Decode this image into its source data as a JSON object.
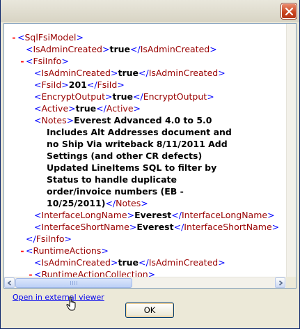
{
  "window": {
    "close_label": "close"
  },
  "xml": {
    "root_open": "SqlFsiModel",
    "root_isadmin_tag": "IsAdminCreated",
    "root_isadmin_val": "true",
    "fsiinfo_tag": "FsiInfo",
    "fsi_isadmin_tag": "IsAdminCreated",
    "fsi_isadmin_val": "true",
    "fsiid_tag": "FsiId",
    "fsiid_val": "201",
    "encrypt_tag": "EncryptOutput",
    "encrypt_val": "true",
    "active_tag": "Active",
    "active_val": "true",
    "notes_tag": "Notes",
    "notes_lines": [
      "Everest Advanced 4.0 to 5.0",
      "Includes Alt Addresses document and",
      "no Ship Via writeback 8/11/2011 Add",
      "Settings (and other CR defects)",
      "Updated LineItems SQL to filter by",
      "Status to handle duplicate",
      "order/invoice numbers (EB -",
      "10/25/2011)"
    ],
    "ilong_tag": "InterfaceLongName",
    "ilong_val": "Everest",
    "ishort_tag": "InterfaceShortName",
    "ishort_val": "Everest",
    "runtime_tag": "RuntimeActions",
    "rt_isadmin_tag": "IsAdminCreated",
    "rt_isadmin_val": "true",
    "rtcoll_tag": "RuntimeActionCollection"
  },
  "footer": {
    "link_text": "Open in external viewer",
    "ok_label": "OK"
  }
}
